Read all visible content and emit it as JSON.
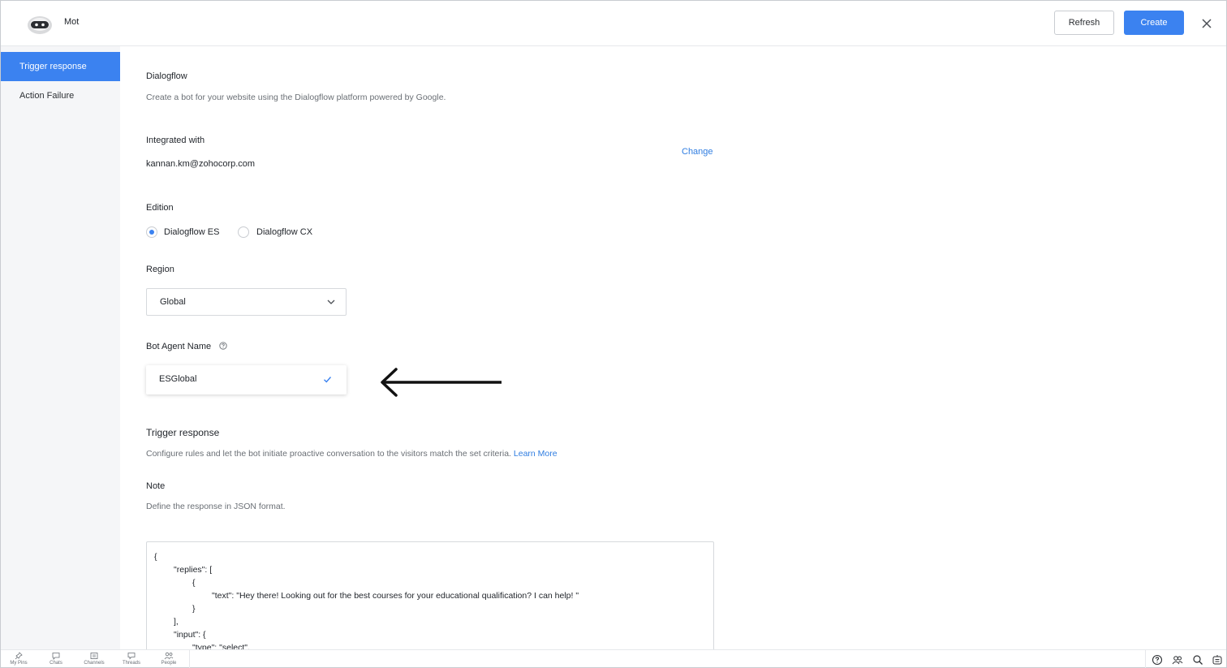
{
  "header": {
    "title": "Mot",
    "refresh_label": "Refresh",
    "create_label": "Create"
  },
  "sidebar": {
    "items": [
      {
        "label": "Trigger response",
        "active": true
      },
      {
        "label": "Action Failure",
        "active": false
      }
    ]
  },
  "main": {
    "platform_title": "Dialogflow",
    "platform_desc": "Create a bot for your website using the Dialogflow platform powered by Google.",
    "integrated_label": "Integrated with",
    "integrated_value": "kannan.km@zohocorp.com",
    "change_label": "Change",
    "edition_label": "Edition",
    "edition_options": [
      "Dialogflow ES",
      "Dialogflow CX"
    ],
    "edition_selected": "Dialogflow ES",
    "region_label": "Region",
    "region_value": "Global",
    "agent_label": "Bot Agent Name",
    "agent_value": "ESGlobal",
    "trigger_title": "Trigger response",
    "trigger_desc": "Configure rules and let the bot initiate proactive conversation to the visitors match the set criteria.",
    "learn_more": "Learn More",
    "note_label": "Note",
    "note_desc": "Define the response in JSON format.",
    "code_lines": [
      "{",
      "\"replies\": [",
      "{",
      "\"text\": \"Hey there! Looking out for the best courses for your educational qualification? I can help! \"",
      "}",
      "],",
      "\"input\": {",
      "\"type\": \"select\","
    ]
  },
  "bottom_nav": {
    "items": [
      "My Pins",
      "Chats",
      "Channels",
      "Threads",
      "People"
    ]
  },
  "colors": {
    "accent": "#3b82f0",
    "link": "#2f7de1",
    "sidebar_bg": "#f5f6f8"
  }
}
